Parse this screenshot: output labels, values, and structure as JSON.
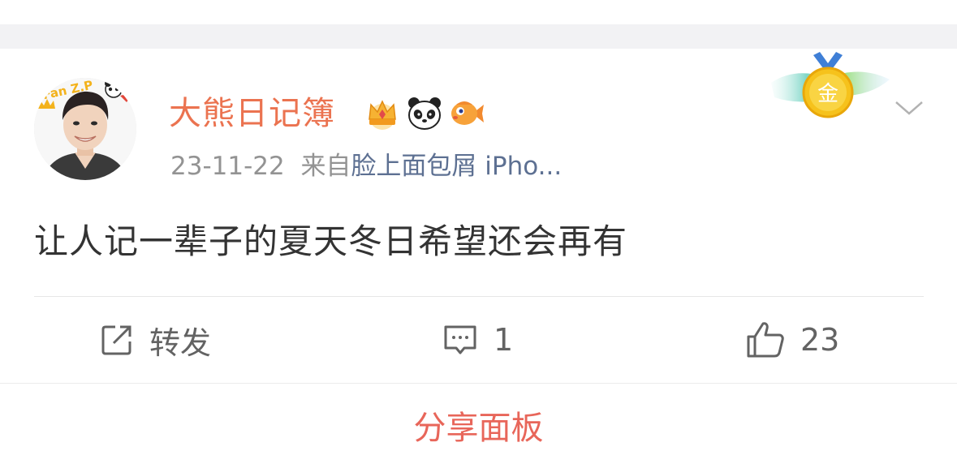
{
  "post": {
    "username": "大熊日记簿",
    "badges": [
      "crown-icon",
      "panda-icon",
      "fish-icon"
    ],
    "avatar_sticker_text": "Fan Z.P",
    "timestamp": "23-11-22",
    "source_prefix": "来自",
    "source_name": "脸上面包屑 iPho...",
    "content": "让人记一辈子的夏天冬日希望还会再有",
    "medal_label": "金"
  },
  "actions": {
    "repost_label": "转发",
    "comment_count": "1",
    "like_count": "23"
  },
  "bottom": {
    "cutoff_text": "分享面板"
  },
  "colors": {
    "username": "#eb7350",
    "source_link": "#5d7092",
    "meta_gray": "#939393",
    "content_text": "#333333",
    "action_gray": "#636363",
    "separator": "#f2f2f4"
  }
}
